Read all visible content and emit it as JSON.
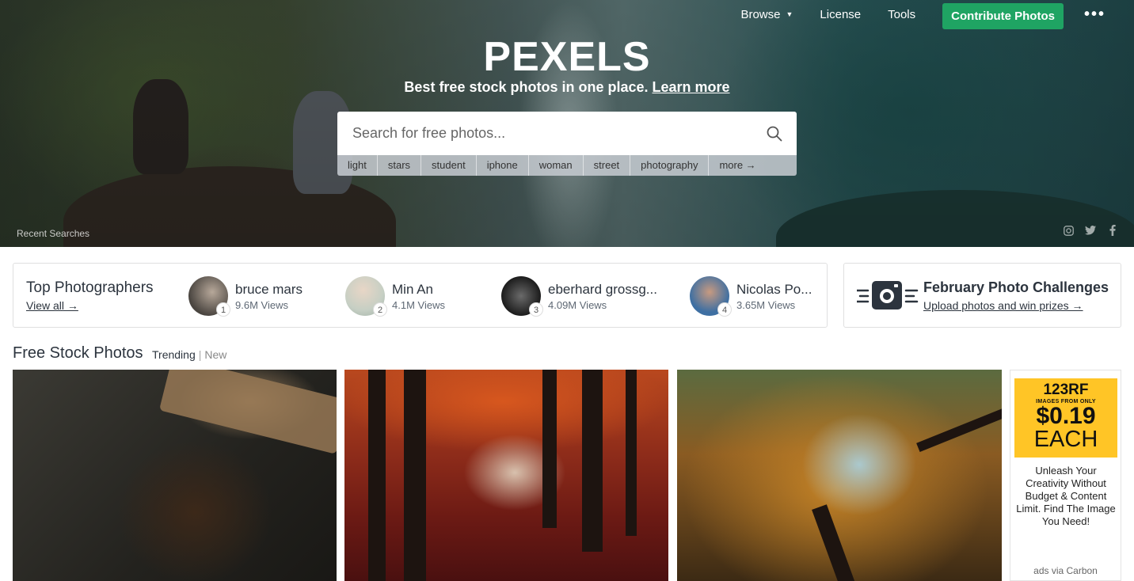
{
  "nav": {
    "browse": "Browse",
    "license": "License",
    "tools": "Tools",
    "contribute": "Contribute Photos",
    "more": "•••"
  },
  "hero": {
    "logo": "PEXELS",
    "tagline": "Best free stock photos in one place.",
    "learn_more": "Learn more",
    "search_placeholder": "Search for free photos...",
    "tags": [
      "light",
      "stars",
      "student",
      "iphone",
      "woman",
      "street",
      "photography",
      "more →"
    ],
    "recent_searches": "Recent Searches"
  },
  "top_photographers": {
    "title": "Top Photographers",
    "view_all": "View all →",
    "people": [
      {
        "name": "bruce mars",
        "views": "9.6M Views",
        "rank": "1"
      },
      {
        "name": "Min An",
        "views": "4.1M Views",
        "rank": "2"
      },
      {
        "name": "eberhard grossg...",
        "views": "4.09M Views",
        "rank": "3"
      },
      {
        "name": "Nicolas Po...",
        "views": "3.65M Views",
        "rank": "4"
      }
    ]
  },
  "challenge": {
    "title": "February Photo Challenges",
    "link": "Upload photos and win prizes →"
  },
  "free_stock": {
    "title": "Free Stock Photos",
    "tab_trending": "Trending",
    "separator": "|",
    "tab_new": "New"
  },
  "ad": {
    "brand": "123RF",
    "small": "IMAGES FROM ONLY",
    "price": "$0.19",
    "each": "EACH",
    "text": "Unleash Your Creativity Without Budget & Content Limit. Find The Image You Need!",
    "via": "ads via Carbon"
  },
  "colors": {
    "accent_green": "#1fa463",
    "ad_yellow": "#ffc526"
  }
}
